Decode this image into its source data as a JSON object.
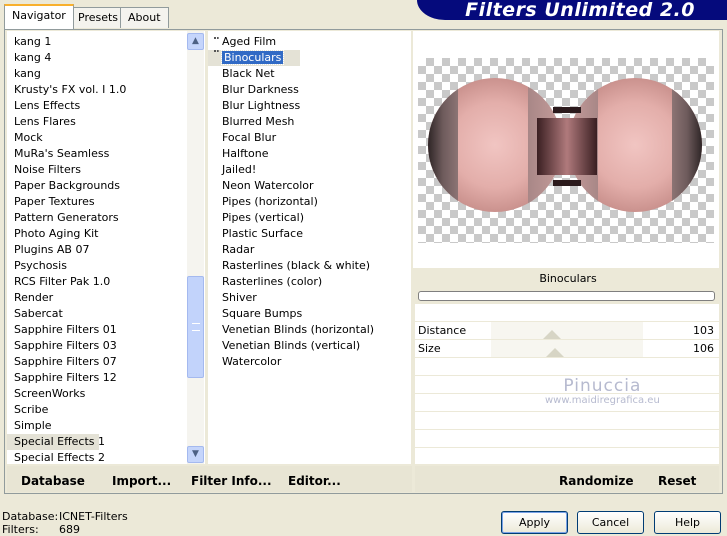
{
  "title": "Filters Unlimited 2.0",
  "tabs": [
    {
      "label": "Navigator",
      "active": true
    },
    {
      "label": "Presets"
    },
    {
      "label": "About"
    }
  ],
  "categories": {
    "items": [
      "kang 1",
      "kang 4",
      "kang",
      "Krusty's FX vol. I 1.0",
      "Lens Effects",
      "Lens Flares",
      "Mock",
      "MuRa's Seamless",
      "Noise Filters",
      "Paper Backgrounds",
      "Paper Textures",
      "Pattern Generators",
      "Photo Aging Kit",
      "Plugins AB 07",
      "Psychosis",
      "RCS Filter Pak 1.0",
      "Render",
      "Sabercat",
      "Sapphire Filters 01",
      "Sapphire Filters 03",
      "Sapphire Filters 07",
      "Sapphire Filters 12",
      "ScreenWorks",
      "Scribe",
      "Simple",
      "Special Effects 1",
      "Special Effects 2"
    ],
    "selected": "Special Effects 1"
  },
  "filters": {
    "items": [
      "Aged Film",
      "Binoculars",
      "Black Net",
      "Blur Darkness",
      "Blur Lightness",
      "Blurred Mesh",
      "Focal Blur",
      "Halftone",
      "Jailed!",
      "Neon Watercolor",
      "Pipes (horizontal)",
      "Pipes (vertical)",
      "Plastic Surface",
      "Radar",
      "Rasterlines (black & white)",
      "Rasterlines (color)",
      "Shiver",
      "Square Bumps",
      "Venetian Blinds (horizontal)",
      "Venetian Blinds (vertical)",
      "Watercolor"
    ],
    "selected": "Binoculars"
  },
  "preview": {
    "filter_name": "Binoculars",
    "params": [
      {
        "label": "Distance",
        "value": "103",
        "level": 0.4
      },
      {
        "label": "Size",
        "value": "106",
        "level": 0.42
      }
    ]
  },
  "watermark": {
    "line1": "Pinuccia",
    "line2": "www.maidiregrafica.eu"
  },
  "toolbar_left": [
    "Database",
    "Import...",
    "Filter Info...",
    "Editor..."
  ],
  "toolbar_right": [
    "Randomize",
    "Reset"
  ],
  "status": {
    "database_label": "Database:",
    "database_value": "ICNET-Filters",
    "filters_label": "Filters:",
    "filters_value": "689"
  },
  "buttons": {
    "apply": "Apply",
    "cancel": "Cancel",
    "help": "Help"
  },
  "colors": {
    "banner": "#050a7c",
    "selection": "#316ac5",
    "window": "#ece9d8"
  }
}
